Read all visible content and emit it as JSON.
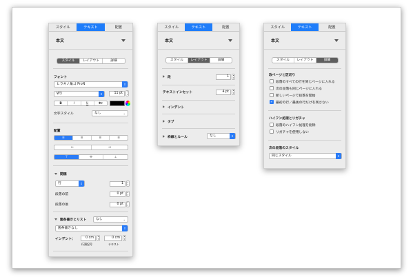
{
  "tabs": {
    "style": "スタイル",
    "text": "テキスト",
    "arrange": "配置"
  },
  "para_style": "本文",
  "sub_tabs": {
    "style": "スタイル",
    "layout": "レイアウト",
    "detail": "詳細"
  },
  "p1": {
    "font_header": "フォント",
    "font_name": "ヒラギノ角ゴ ProN",
    "font_weight": "W3",
    "font_size": "11 pt",
    "bold": "B",
    "italic": "I",
    "underline": "U",
    "gear": "✱▾",
    "char_style_label": "文字スタイル",
    "char_style_value": "なし",
    "align_header": "配置",
    "align_buttons": [
      "≡",
      "≡",
      "≡",
      "≡"
    ],
    "indent_buttons": [
      "⇤",
      "⇥"
    ],
    "valign_buttons": [
      "⊤",
      "✢",
      "⊥"
    ],
    "spacing_header": "間隔",
    "spacing_unit": "行",
    "spacing_value": "1",
    "before_label": "段落の前",
    "before_value": "0 pt",
    "after_label": "段落の後",
    "after_value": "0 pt",
    "bullets_label": "箇条書きとリスト",
    "bullets_value": "なし",
    "bullets_type": "箇条書きなし",
    "indent_label": "インデント：",
    "indent_bullet_value": "0 cm",
    "indent_text_value": "0 cm",
    "bullet_caption": "行頭記号",
    "text_caption": "テキスト"
  },
  "p2": {
    "columns_label": "段",
    "columns_value": "1",
    "inset_label": "テキストインセット",
    "inset_value": "4 pt",
    "indent_label": "インデント",
    "tabs_label": "タブ",
    "borders_label": "枠線とルール",
    "borders_value": "なし"
  },
  "p3": {
    "pagination_header": "改ページと区切り",
    "options": [
      {
        "label": "段落のすべての行を同じページに入れる",
        "checked": false
      },
      {
        "label": "次の段落も同じページに入れる",
        "checked": false
      },
      {
        "label": "新しいページで段落を開始",
        "checked": false
      },
      {
        "label": "最初の行／最後の行だけを残さない",
        "checked": true
      }
    ],
    "hyphen_header": "ハイフン処理とリガチャ",
    "hyphen_options": [
      {
        "label": "段落のハイフン処理を削除",
        "checked": false
      },
      {
        "label": "リガチャを使用しない",
        "checked": false
      }
    ],
    "next_style_label": "次の段落のスタイル",
    "next_style_value": "同じスタイル"
  },
  "colors": {
    "accent": "#1f7dfa",
    "panel_bg": "#ececec"
  }
}
